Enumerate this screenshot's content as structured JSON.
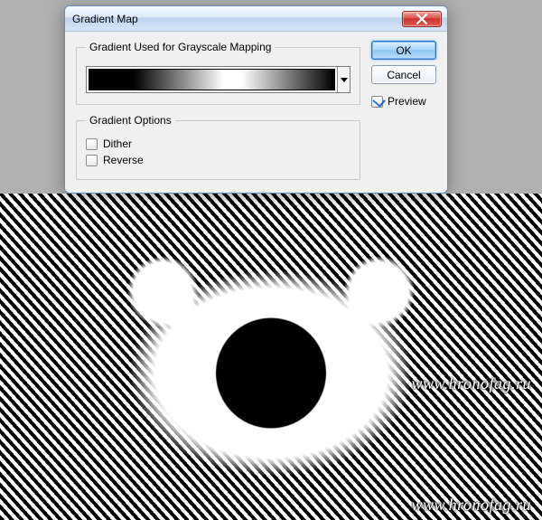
{
  "dialog": {
    "title": "Gradient Map",
    "group_gradient_label": "Gradient Used for Grayscale Mapping",
    "group_options_label": "Gradient Options",
    "options": {
      "dither": {
        "label": "Dither",
        "checked": false
      },
      "reverse": {
        "label": "Reverse",
        "checked": false
      }
    },
    "buttons": {
      "ok": "OK",
      "cancel": "Cancel"
    },
    "preview": {
      "label": "Preview",
      "checked": true
    }
  },
  "watermark": "www.hronofag.ru"
}
